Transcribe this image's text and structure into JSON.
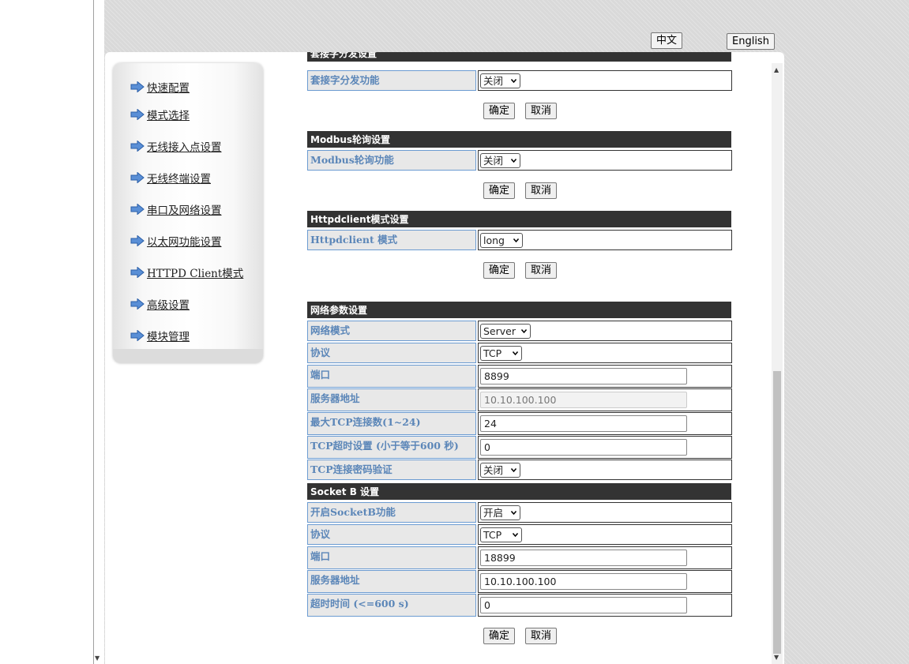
{
  "lang": {
    "chinese": "中文",
    "english": "English"
  },
  "nav": [
    {
      "label": "快速配置"
    },
    {
      "label": "模式选择"
    },
    {
      "label": "无线接入点设置"
    },
    {
      "label": "无线终端设置"
    },
    {
      "label": "串口及网络设置"
    },
    {
      "label": "以太网功能设置"
    },
    {
      "label": "HTTPD Client模式"
    },
    {
      "label": "高级设置"
    },
    {
      "label": "模块管理"
    }
  ],
  "buttons": {
    "confirm": "确定",
    "cancel": "取消"
  },
  "socket_dist": {
    "title": "套接字分发设置",
    "label": "套接字分发功能",
    "value": "关闭"
  },
  "modbus": {
    "title": "Modbus轮询设置",
    "label": "Modbus轮询功能",
    "value": "关闭"
  },
  "httpd": {
    "title": "Httpdclient模式设置",
    "label": "Httpdclient 模式",
    "value": "long"
  },
  "network": {
    "title": "网络参数设置",
    "mode_label": "网络模式",
    "mode_value": "Server",
    "protocol_label": "协议",
    "protocol_value": "TCP",
    "port_label": "端口",
    "port_value": "8899",
    "server_label": "服务器地址",
    "server_value": "10.10.100.100",
    "maxconn_label": "最大TCP连接数(1~24)",
    "maxconn_value": "24",
    "timeout_label": "TCP超时设置 (小于等于600 秒)",
    "timeout_value": "0",
    "pwd_label": "TCP连接密码验证",
    "pwd_value": "关闭"
  },
  "socketb": {
    "title": "Socket B 设置",
    "enable_label": "开启SocketB功能",
    "enable_value": "开启",
    "protocol_label": "协议",
    "protocol_value": "TCP",
    "port_label": "端口",
    "port_value": "18899",
    "server_label": "服务器地址",
    "server_value": "10.10.100.100",
    "timeout_label": "超时时间 (<=600 s)",
    "timeout_value": "0"
  }
}
